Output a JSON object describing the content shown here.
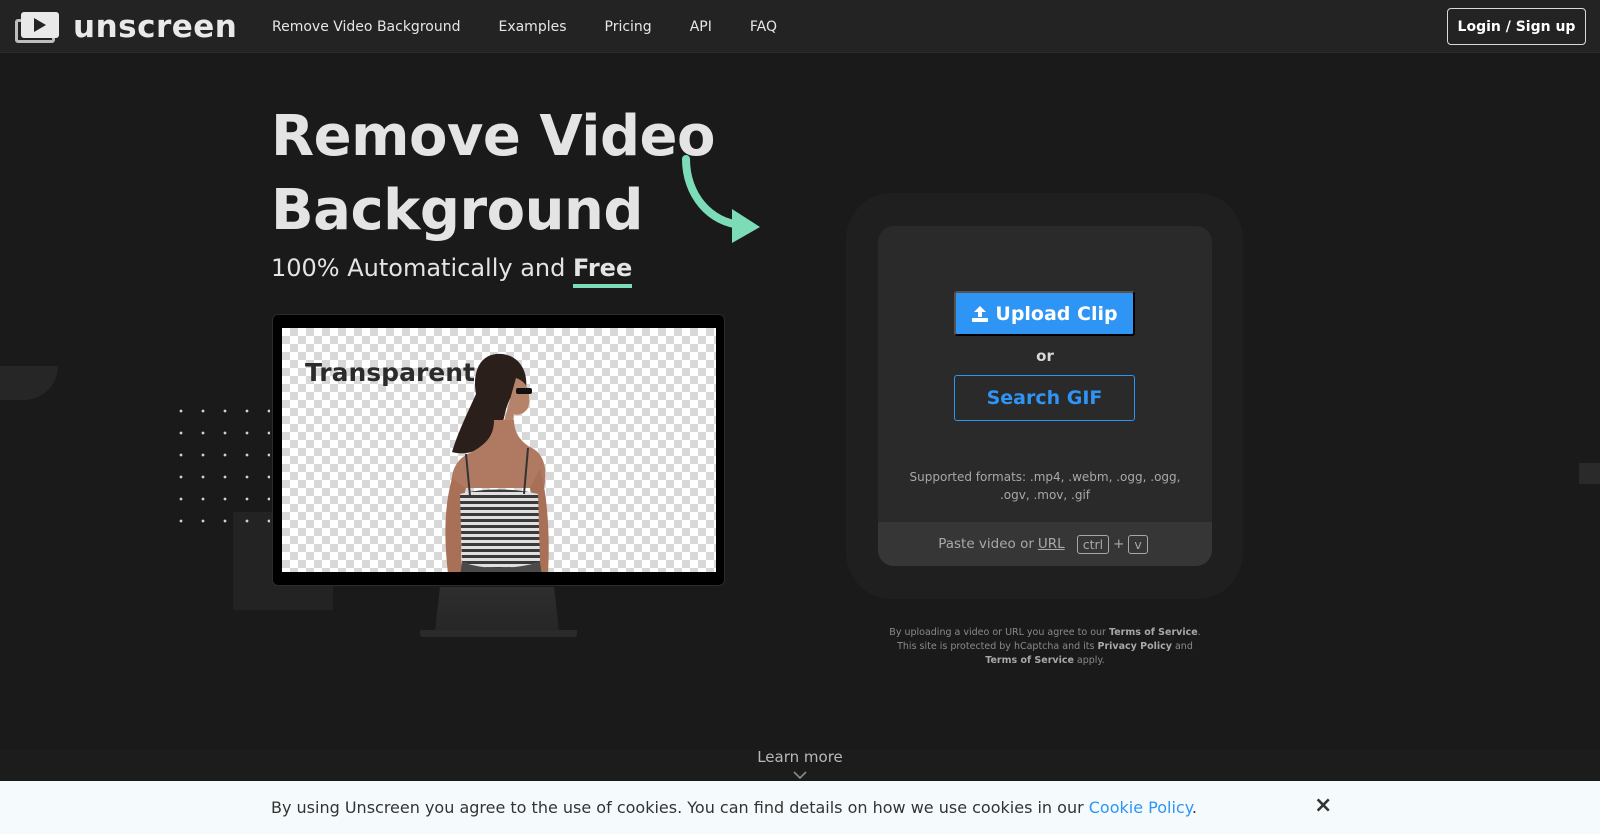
{
  "brand": {
    "name": "unscreen"
  },
  "nav": {
    "links": [
      {
        "label": "Remove Video Background"
      },
      {
        "label": "Examples"
      },
      {
        "label": "Pricing"
      },
      {
        "label": "API"
      },
      {
        "label": "FAQ"
      }
    ],
    "login_label": "Login / Sign up"
  },
  "hero": {
    "title_line1": "Remove Video",
    "title_line2": "Background",
    "subtitle_prefix": "100% Automatically and ",
    "subtitle_emphasis": "Free",
    "preview_label": "Transparent"
  },
  "upload": {
    "upload_label": "Upload Clip",
    "or_label": "or",
    "search_gif_label": "Search GIF",
    "formats": "Supported formats: .mp4, .webm, .ogg, .ogg, .ogv, .mov, .gif",
    "paste_prefix": "Paste video or",
    "paste_url": "URL",
    "key_ctrl": "ctrl",
    "key_plus": "+",
    "key_v": "v"
  },
  "legal": {
    "part1": "By uploading a video or URL you agree to our ",
    "tos": "Terms of Service",
    "part2": ". This site is protected by hCaptcha and its ",
    "privacy": "Privacy Policy",
    "part3": " and ",
    "tos2": "Terms of Service",
    "part4": " apply."
  },
  "learn_more": "Learn more",
  "cookie": {
    "text": "By using Unscreen you agree to the use of cookies. You can find details on how we use cookies in our ",
    "link": "Cookie Policy",
    "end": ".",
    "close": "×"
  },
  "colors": {
    "accent_blue": "#2f95f5",
    "accent_green": "#7ddcb8",
    "background": "#1a1a1a"
  }
}
